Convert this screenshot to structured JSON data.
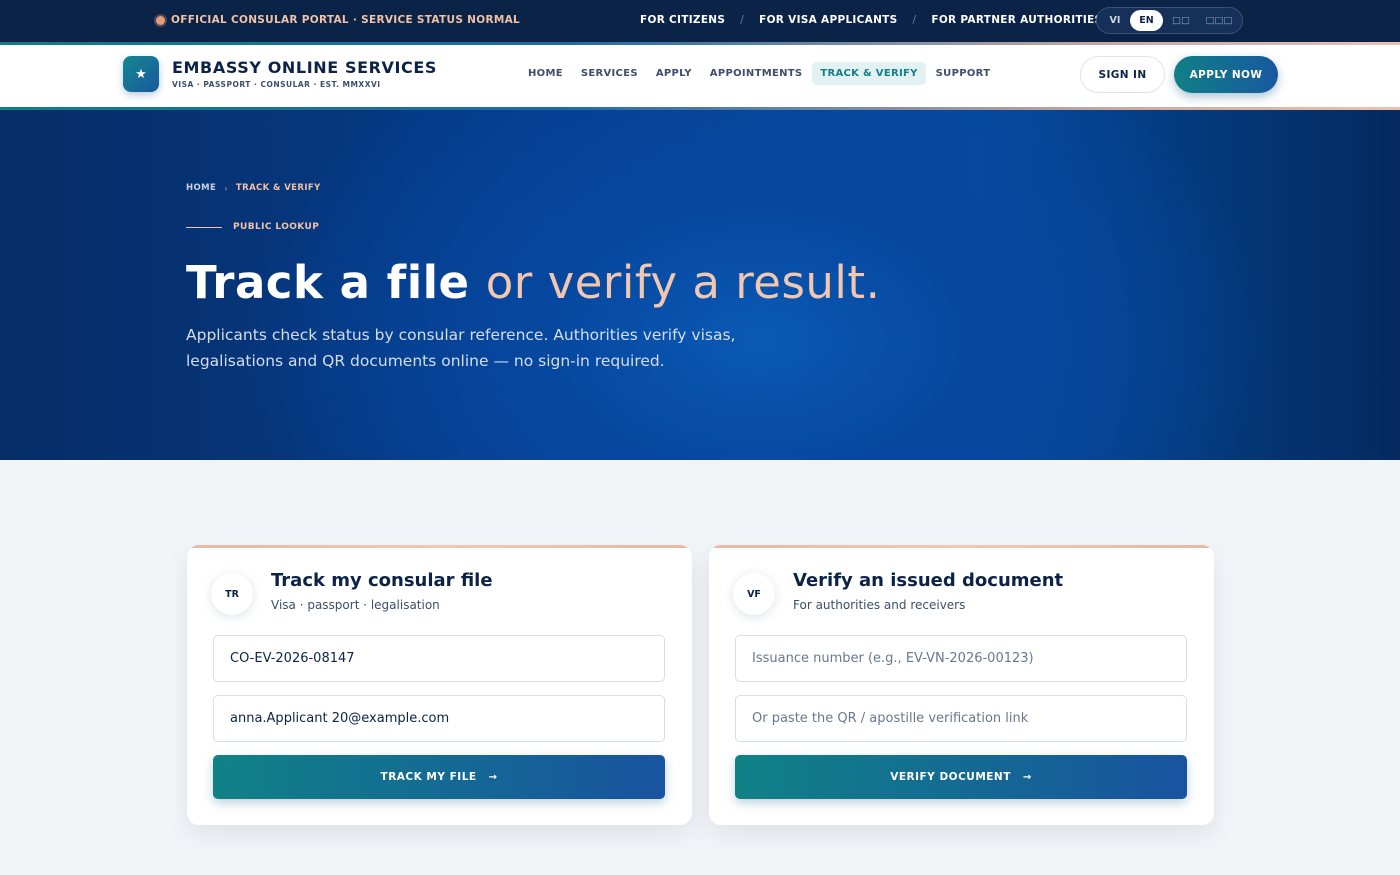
{
  "utility_bar": {
    "status": "OFFICIAL CONSULAR PORTAL · SERVICE STATUS NORMAL",
    "audiences": [
      "FOR CITIZENS",
      "FOR VISA APPLICANTS",
      "FOR PARTNER AUTHORITIES"
    ],
    "separator": "/",
    "languages": [
      "VI",
      "EN",
      "□□",
      "□□□"
    ],
    "active_language": "EN"
  },
  "header": {
    "logo_glyph": "★",
    "brand_title": "EMBASSY ONLINE SERVICES",
    "brand_subtitle": "VISA · PASSPORT · CONSULAR · EST. MMXXVI",
    "nav": [
      "HOME",
      "SERVICES",
      "APPLY",
      "APPOINTMENTS",
      "TRACK & VERIFY",
      "SUPPORT"
    ],
    "active_nav": "TRACK & VERIFY",
    "sign_in_label": "SIGN IN",
    "apply_label": "APPLY NOW"
  },
  "hero": {
    "breadcrumb": [
      "HOME",
      "TRACK & VERIFY"
    ],
    "breadcrumb_separator": "›",
    "eyebrow": "PUBLIC LOOKUP",
    "headline_strong": "Track a file",
    "headline_light": "or verify a result.",
    "lede": "Applicants check status by consular reference. Authorities verify visas, legalisations and QR documents online — no sign-in required."
  },
  "track_card": {
    "badge": "TR",
    "title": "Track my consular file",
    "subtitle": "Visa · passport · legalisation",
    "reference_value": "CO-EV-2026-08147",
    "email_value": "anna.Applicant 20@example.com",
    "button_label": "TRACK MY FILE",
    "button_arrow": "→"
  },
  "verify_card": {
    "badge": "VF",
    "title": "Verify an issued document",
    "subtitle": "For authorities and receivers",
    "issuance_placeholder": "Issuance number (e.g., EV-VN-2026-00123)",
    "link_placeholder": "Or paste the QR / apostille verification link",
    "button_label": "VERIFY DOCUMENT",
    "button_arrow": "→"
  },
  "colors": {
    "navy": "#0b2347",
    "teal": "#117f86",
    "royal_blue": "#1858a0",
    "peach": "#f0c2a8",
    "page_bg": "#f2f5f8"
  }
}
